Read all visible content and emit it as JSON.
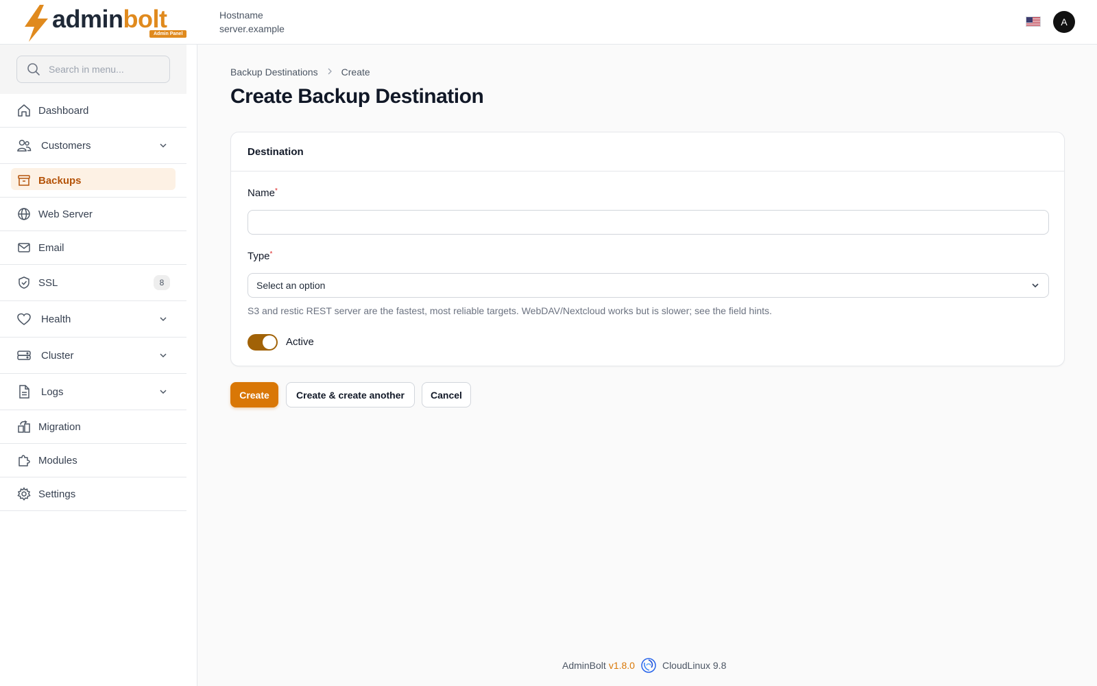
{
  "header": {
    "logo_admin": "admin",
    "logo_bolt": "bolt",
    "logo_badge": "Admin Panel",
    "hostname_label": "Hostname",
    "hostname_value": "server.example",
    "avatar_initial": "A",
    "flag_icon": "us-flag-icon"
  },
  "sidebar": {
    "search_placeholder": "Search in menu...",
    "items": [
      {
        "label": "Dashboard",
        "icon": "home-icon"
      },
      {
        "label": "Customers",
        "icon": "users-icon",
        "expandable": true
      },
      {
        "label": "Backups",
        "icon": "archive-icon",
        "active": true
      },
      {
        "label": "Web Server",
        "icon": "globe-icon"
      },
      {
        "label": "Email",
        "icon": "mail-icon"
      },
      {
        "label": "SSL",
        "icon": "shield-icon",
        "badge": "8"
      },
      {
        "label": "Health",
        "icon": "heart-icon",
        "expandable": true
      },
      {
        "label": "Cluster",
        "icon": "server-icon",
        "expandable": true
      },
      {
        "label": "Logs",
        "icon": "document-icon",
        "expandable": true
      },
      {
        "label": "Migration",
        "icon": "migration-icon"
      },
      {
        "label": "Modules",
        "icon": "puzzle-icon"
      },
      {
        "label": "Settings",
        "icon": "gear-icon"
      }
    ]
  },
  "main": {
    "breadcrumb": [
      "Backup Destinations",
      "Create"
    ],
    "title": "Create Backup Destination",
    "section_title": "Destination",
    "name_label": "Name",
    "name_value": "",
    "type_label": "Type",
    "type_value": "Select an option",
    "type_hint": "S3 and restic REST server are the fastest, most reliable targets. WebDAV/Nextcloud works but is slower; see the field hints.",
    "active_label": "Active",
    "active_on": true,
    "required_mark": "*",
    "buttons": {
      "create": "Create",
      "create_another": "Create & create another",
      "cancel": "Cancel"
    }
  },
  "footer": {
    "app": "AdminBolt",
    "version": "v1.8.0",
    "os": "CloudLinux 9.8"
  },
  "colors": {
    "accent": "#d97706",
    "toggle": "#a16207",
    "active_bg": "#fdf1e4",
    "active_text": "#b45309"
  }
}
